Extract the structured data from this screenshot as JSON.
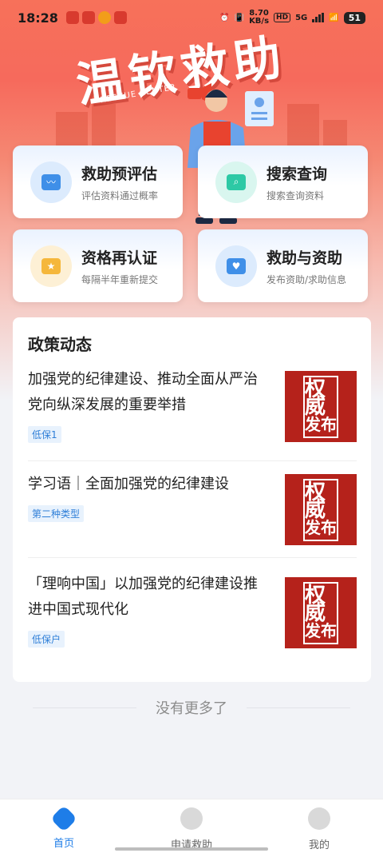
{
  "status_bar": {
    "time": "18:28",
    "net_speed_value": "8.70",
    "net_speed_unit": "KB/s",
    "hd": "HD",
    "network": "5G",
    "battery": "51"
  },
  "hero": {
    "title": "温钦救助",
    "subtitle": "RESCUE CENTER"
  },
  "quick_cards": [
    {
      "title": "救助预评估",
      "subtitle": "评估资料通过概率",
      "icon": "monitor-icon",
      "color": "#3f8fe8"
    },
    {
      "title": "搜索查询",
      "subtitle": "搜索查询资料",
      "icon": "search-icon",
      "color": "#2dc9a5"
    },
    {
      "title": "资格再认证",
      "subtitle": "每隔半年重新提交",
      "icon": "star-icon",
      "color": "#f5b73b"
    },
    {
      "title": "救助与资助",
      "subtitle": "发布资助/求助信息",
      "icon": "heart-icon",
      "color": "#3f8fe8"
    }
  ],
  "policy": {
    "title": "政策动态",
    "items": [
      {
        "headline": "加强党的纪律建设、推动全面从严治党向纵深发展的重要举措",
        "tag": "低保1",
        "thumb_a": "权威",
        "thumb_b": "发布"
      },
      {
        "headline": "学习语｜全面加强党的纪律建设",
        "tag": "第二种类型",
        "thumb_a": "权威",
        "thumb_b": "发布"
      },
      {
        "headline": "「理响中国」以加强党的纪律建设推进中国式现代化",
        "tag": "低保户",
        "thumb_a": "权威",
        "thumb_b": "发布"
      }
    ]
  },
  "no_more": "没有更多了",
  "tabbar": [
    {
      "label": "首页",
      "active": true
    },
    {
      "label": "申请救助",
      "active": false
    },
    {
      "label": "我的",
      "active": false
    }
  ]
}
